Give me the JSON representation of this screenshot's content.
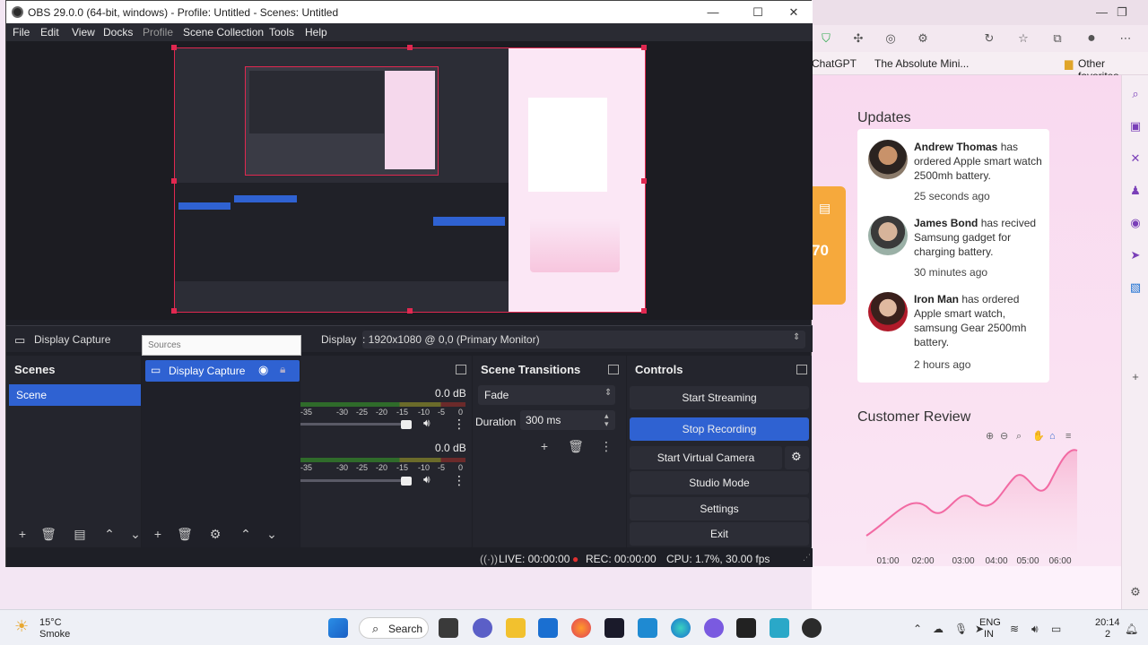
{
  "obs": {
    "window_title": "OBS 29.0.0 (64-bit, windows) - Profile: Untitled - Scenes: Untitled",
    "menu": [
      "File",
      "Edit",
      "View",
      "Docks",
      "Profile",
      "Scene Collection",
      "Tools",
      "Help"
    ],
    "source_toolbar": {
      "source_name": "Display Capture",
      "display_label": "Display",
      "display_value": ": 1920x1080 @ 0,0 (Primary Monitor)"
    },
    "scenes": {
      "title": "Scenes",
      "items": [
        "Scene"
      ]
    },
    "sources": {
      "tooltip": "Sources",
      "items": [
        "Display Capture"
      ]
    },
    "mixer": {
      "channels": [
        {
          "db": "0.0 dB"
        },
        {
          "db": "0.0 dB"
        }
      ],
      "ticks": [
        "-35",
        "-30",
        "-25",
        "-20",
        "-15",
        "-10",
        "-5",
        "0"
      ]
    },
    "transitions": {
      "title": "Scene Transitions",
      "selected": "Fade",
      "duration_label": "Duration",
      "duration_value": "300 ms"
    },
    "controls": {
      "title": "Controls",
      "start_streaming": "Start Streaming",
      "stop_recording": "Stop Recording",
      "start_virtual_camera": "Start Virtual Camera",
      "studio_mode": "Studio Mode",
      "settings": "Settings",
      "exit": "Exit"
    },
    "status": {
      "live": "LIVE: 00:00:00",
      "rec": "REC: 00:00:00",
      "cpu": "CPU: 1.7%, 30.00 fps"
    }
  },
  "browser": {
    "bookmark_1": "ChatGPT",
    "bookmark_2": "The Absolute Mini...",
    "bookmark_3": "Other favorites",
    "orange_card_value": "70",
    "updates_title": "Updates",
    "updates": [
      {
        "name": "Andrew Thomas",
        "text": " has ordered Apple smart watch 2500mh battery.",
        "time": "25 seconds ago"
      },
      {
        "name": "James Bond",
        "text": " has recived Samsung gadget for charging battery.",
        "time": "30 minutes ago"
      },
      {
        "name": "Iron Man",
        "text": " has ordered Apple smart watch, samsung Gear 2500mh battery.",
        "time": "2 hours ago"
      }
    ],
    "review_title": "Customer Review",
    "review_axis": [
      "01:00",
      "02:00",
      "03:00",
      "04:00",
      "05:00",
      "06:00"
    ]
  },
  "taskbar": {
    "weather_temp": "15°C",
    "weather_desc": "Smoke",
    "search_label": "Search",
    "lang_line1": "ENG",
    "lang_line2": "IN",
    "time": "20:14",
    "date": "2"
  },
  "colors": {
    "obs_accent": "#2f62d2",
    "preview_border": "#e02850",
    "chart_pink": "#f26aa3"
  }
}
